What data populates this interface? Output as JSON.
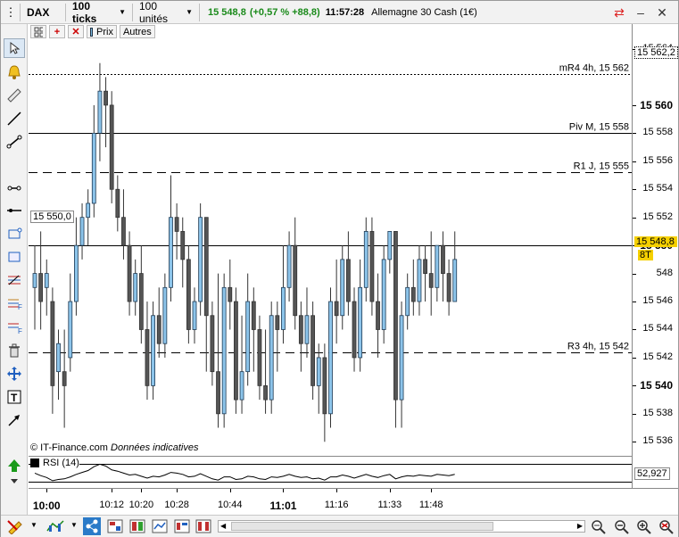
{
  "toolbar": {
    "symbol": "DAX",
    "period": "100 ticks",
    "units": "100 unités",
    "last": "15 548,8",
    "change": "(+0,57 % +88,8)",
    "time": "11:57:28",
    "instrument": "Allemagne 30 Cash (1€)"
  },
  "chart_header": {
    "price_btn": "Prix",
    "others_btn": "Autres"
  },
  "levels": [
    {
      "label": "mR4 4h, 15 562",
      "value": 15562.2,
      "style": "dotted"
    },
    {
      "label": "Piv M, 15 558",
      "value": 15558.0,
      "style": "solid"
    },
    {
      "label": "R1 J, 15 555",
      "value": 15555.2,
      "style": "dashed"
    },
    {
      "label": "",
      "value": 15550.0,
      "style": "solid"
    },
    {
      "label": "R3 4h, 15 542",
      "value": 15542.4,
      "style": "dashed"
    }
  ],
  "level_tag": "15 550,0",
  "price_tags": {
    "mr4": "15 562,2",
    "last": "15 548,8",
    "ticks_left": "8T",
    "rsi_value": "52,927"
  },
  "watermark": {
    "source": "© IT-Finance.com",
    "note": "Données indicatives"
  },
  "rsi_label": "RSI (14)",
  "chart_data": {
    "type": "candlestick",
    "ylim": [
      15535,
      15564.7
    ],
    "y_ticks": [
      {
        "v": 15564,
        "label": "15 564",
        "bold": false
      },
      {
        "v": 15560,
        "label": "15 560",
        "bold": true
      },
      {
        "v": 15558,
        "label": "15 558",
        "bold": false
      },
      {
        "v": 15556,
        "label": "15 556",
        "bold": false
      },
      {
        "v": 15554,
        "label": "15 554",
        "bold": false
      },
      {
        "v": 15552,
        "label": "15 552",
        "bold": false
      },
      {
        "v": 15550,
        "label": "15 550",
        "bold": true
      },
      {
        "v": 15548,
        "label": "548",
        "bold": false
      },
      {
        "v": 15546,
        "label": "15 546",
        "bold": false
      },
      {
        "v": 15544,
        "label": "15 544",
        "bold": false
      },
      {
        "v": 15542,
        "label": "15 542",
        "bold": false
      },
      {
        "v": 15540,
        "label": "15 540",
        "bold": true
      },
      {
        "v": 15538,
        "label": "15 538",
        "bold": false
      },
      {
        "v": 15536,
        "label": "15 536",
        "bold": false
      }
    ],
    "x_ticks": [
      {
        "i": 2,
        "label": "10:00",
        "bold": true
      },
      {
        "i": 13,
        "label": "10:12",
        "bold": false
      },
      {
        "i": 18,
        "label": "10:20",
        "bold": false
      },
      {
        "i": 24,
        "label": "10:28",
        "bold": false
      },
      {
        "i": 33,
        "label": "10:44",
        "bold": false
      },
      {
        "i": 42,
        "label": "11:01",
        "bold": true
      },
      {
        "i": 51,
        "label": "11:16",
        "bold": false
      },
      {
        "i": 60,
        "label": "11:33",
        "bold": false
      },
      {
        "i": 67,
        "label": "11:48",
        "bold": false
      }
    ],
    "candles": [
      [
        15547,
        15548,
        15544,
        15550
      ],
      [
        15548,
        15546,
        15544,
        15551
      ],
      [
        15547,
        15548,
        15545,
        15549
      ],
      [
        15546,
        15540,
        15538,
        15547
      ],
      [
        15541,
        15543,
        15539,
        15544
      ],
      [
        15541,
        15540,
        15537,
        15544
      ],
      [
        15542,
        15546,
        15541,
        15548
      ],
      [
        15546,
        15550,
        15545,
        15552
      ],
      [
        15550,
        15552,
        15549,
        15553
      ],
      [
        15552,
        15553,
        15550,
        15554
      ],
      [
        15553,
        15558,
        15552,
        15560
      ],
      [
        15558,
        15561,
        15556,
        15563
      ],
      [
        15561,
        15560,
        15557,
        15562
      ],
      [
        15560,
        15554,
        15553,
        15561
      ],
      [
        15554,
        15552,
        15551,
        15555
      ],
      [
        15552,
        15550,
        15549,
        15554
      ],
      [
        15550,
        15546,
        15545,
        15551
      ],
      [
        15546,
        15548,
        15545,
        15549
      ],
      [
        15548,
        15544,
        15543,
        15550
      ],
      [
        15544,
        15540,
        15539,
        15546
      ],
      [
        15540,
        15545,
        15539,
        15546
      ],
      [
        15545,
        15543,
        15542,
        15547
      ],
      [
        15543,
        15547,
        15542,
        15548
      ],
      [
        15547,
        15552,
        15546,
        15555
      ],
      [
        15552,
        15551,
        15549,
        15553
      ],
      [
        15551,
        15549,
        15547,
        15552
      ],
      [
        15549,
        15544,
        15543,
        15550
      ],
      [
        15544,
        15546,
        15543,
        15547
      ],
      [
        15546,
        15552,
        15545,
        15553
      ],
      [
        15552,
        15545,
        15541,
        15552
      ],
      [
        15545,
        15541,
        15540,
        15546
      ],
      [
        15541,
        15538,
        15537,
        15548
      ],
      [
        15538,
        15547,
        15537,
        15548
      ],
      [
        15547,
        15546,
        15544,
        15549
      ],
      [
        15546,
        15539,
        15538,
        15547
      ],
      [
        15539,
        15541,
        15538,
        15545
      ],
      [
        15541,
        15546,
        15540,
        15548
      ],
      [
        15546,
        15544,
        15541,
        15547
      ],
      [
        15544,
        15540,
        15539,
        15545
      ],
      [
        15540,
        15539,
        15538,
        15544
      ],
      [
        15539,
        15545,
        15538,
        15546
      ],
      [
        15545,
        15544,
        15541,
        15546
      ],
      [
        15544,
        15547,
        15543,
        15550
      ],
      [
        15547,
        15550,
        15546,
        15551
      ],
      [
        15550,
        15545,
        15544,
        15552
      ],
      [
        15545,
        15543,
        15541,
        15546
      ],
      [
        15543,
        15545,
        15542,
        15547
      ],
      [
        15545,
        15540,
        15539,
        15546
      ],
      [
        15540,
        15542,
        15538,
        15543
      ],
      [
        15542,
        15538,
        15536,
        15543
      ],
      [
        15538,
        15546,
        15537,
        15547
      ],
      [
        15546,
        15545,
        15543,
        15549
      ],
      [
        15545,
        15549,
        15544,
        15550
      ],
      [
        15549,
        15546,
        15545,
        15551
      ],
      [
        15546,
        15542,
        15541,
        15547
      ],
      [
        15542,
        15547,
        15541,
        15549
      ],
      [
        15547,
        15551,
        15546,
        15552
      ],
      [
        15551,
        15546,
        15545,
        15552
      ],
      [
        15546,
        15544,
        15542,
        15548
      ],
      [
        15544,
        15549,
        15543,
        15550
      ],
      [
        15549,
        15551,
        15548,
        15551
      ],
      [
        15551,
        15539,
        15537,
        15551
      ],
      [
        15539,
        15545,
        15537,
        15546
      ],
      [
        15545,
        15547,
        15544,
        15548
      ],
      [
        15547,
        15546,
        15545,
        15549
      ],
      [
        15546,
        15549,
        15545,
        15550
      ],
      [
        15549,
        15548,
        15546,
        15550
      ],
      [
        15548,
        15547,
        15545,
        15551
      ],
      [
        15547,
        15550,
        15546,
        15550
      ],
      [
        15550,
        15548,
        15546,
        15551
      ],
      [
        15548,
        15546,
        15545,
        15549
      ],
      [
        15546,
        15549,
        15546,
        15551
      ]
    ],
    "rsi": [
      52,
      48,
      45,
      40,
      42,
      43,
      46,
      50,
      53,
      56,
      62,
      66,
      63,
      57,
      55,
      52,
      49,
      50,
      47,
      44,
      47,
      46,
      49,
      53,
      52,
      50,
      46,
      47,
      51,
      47,
      43,
      41,
      46,
      46,
      42,
      43,
      47,
      46,
      43,
      42,
      46,
      45,
      47,
      50,
      47,
      45,
      46,
      43,
      44,
      41,
      46,
      46,
      49,
      47,
      44,
      47,
      50,
      47,
      45,
      48,
      50,
      43,
      46,
      48,
      47,
      49,
      48,
      47,
      50,
      49,
      48,
      50
    ]
  }
}
